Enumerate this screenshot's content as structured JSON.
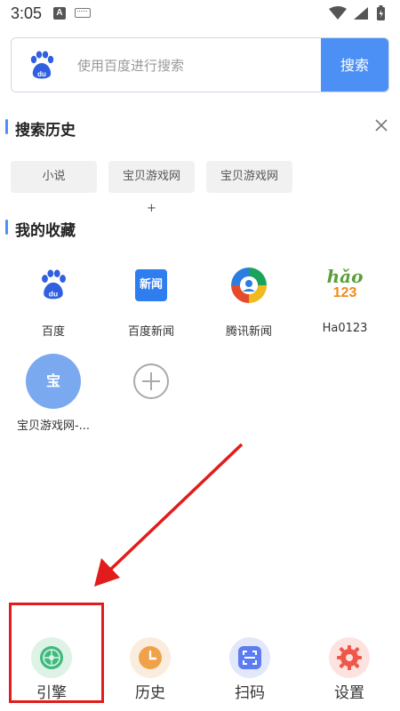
{
  "status_bar": {
    "time": "3:05",
    "notification_a": "A"
  },
  "search": {
    "placeholder": "使用百度进行搜索",
    "button_label": "搜索"
  },
  "history": {
    "title": "搜索历史",
    "items": [
      "小说",
      "宝贝游戏网+",
      "宝贝游戏网"
    ]
  },
  "favorites": {
    "title": "我的收藏",
    "items": [
      {
        "label": "百度",
        "icon": "baidu-icon"
      },
      {
        "label": "百度新闻",
        "icon": "baidu-news-icon"
      },
      {
        "label": "腾讯新闻",
        "icon": "tencent-news-icon"
      },
      {
        "label": "Ha0123",
        "icon": "hao123-icon"
      },
      {
        "label": "宝贝游戏网-...",
        "icon": "baby-icon",
        "icon_text": "宝"
      }
    ],
    "add_icon": "plus-icon"
  },
  "icons": {
    "baidu_news_text": "新闻",
    "hao123_top": "hǎo",
    "hao123_bottom": "123"
  },
  "bottom_nav": {
    "items": [
      {
        "label": "引擎",
        "icon": "engine-icon",
        "color": "#3fb97f"
      },
      {
        "label": "历史",
        "icon": "clock-icon",
        "color": "#f0a24a"
      },
      {
        "label": "扫码",
        "icon": "scan-icon",
        "color": "#5b7cf2"
      },
      {
        "label": "设置",
        "icon": "gear-icon",
        "color": "#f0564a"
      }
    ]
  },
  "colors": {
    "accent": "#4d90f5",
    "annotation_red": "#e21c1c"
  }
}
